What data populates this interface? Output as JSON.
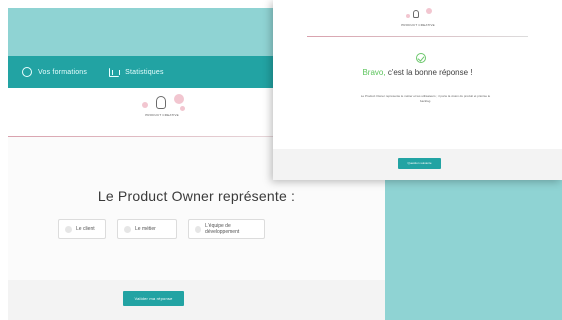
{
  "nav": {
    "items": [
      {
        "label": "Vos formations",
        "icon": "clock-icon"
      },
      {
        "label": "Statistiques",
        "icon": "chart-icon"
      }
    ]
  },
  "brand": {
    "logo_text": "PRODUCT CREATIVE"
  },
  "quiz": {
    "question": "Le Product Owner représente :",
    "answers": [
      "Le client",
      "Le métier",
      "L'équipe de développement"
    ],
    "validate_label": "Valider ma réponse"
  },
  "modal": {
    "logo_text": "PRODUCT CREATIVE",
    "title_accent": "Bravo,",
    "title_rest": " c'est la bonne réponse !",
    "explanation": "Le Product Owner représente le métier et les utilisateurs ; il porte la vision du produit et priorise le backlog.",
    "next_label": "Question suivante"
  },
  "colors": {
    "teal": "#22a3a3",
    "teal_light": "#8fd3d3",
    "success": "#5cc45c",
    "accent_pink": "#d9a1ad"
  }
}
